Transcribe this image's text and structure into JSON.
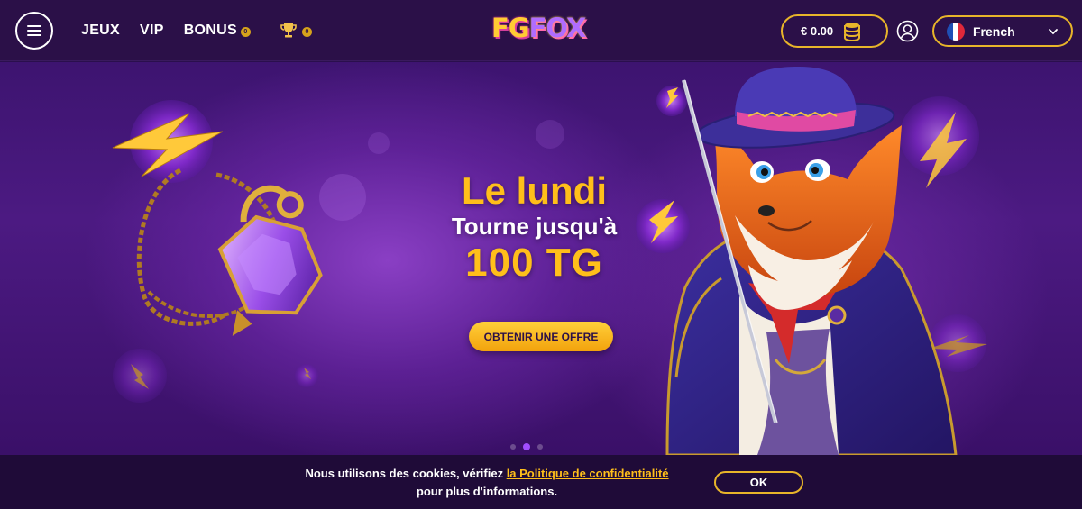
{
  "header": {
    "nav": {
      "games": "JEUX",
      "vip": "VIP",
      "bonus": "BONUS",
      "bonus_count": "0",
      "tournaments_count": "0"
    },
    "logo": {
      "part1": "FG",
      "part2": "FOX"
    },
    "balance": "€ 0.00",
    "language": "French"
  },
  "hero": {
    "title": "Le lundi",
    "subtitle": "Tourne jusqu'à",
    "amount": "100 TG",
    "cta_label": "OBTENIR UNE OFFRE",
    "slides": 3,
    "active_slide": 2
  },
  "cookie": {
    "text_before": "Nous utilisons des cookies, vérifiez ",
    "link_text": "la Politique de confidentialité",
    "text_after": "pour plus d'informations.",
    "ok_label": "OK"
  },
  "colors": {
    "accent": "#e8b52a",
    "promo_yellow": "#ffbf1a",
    "header_bg": "#2b1048",
    "cookie_bg": "#1f0b38"
  }
}
